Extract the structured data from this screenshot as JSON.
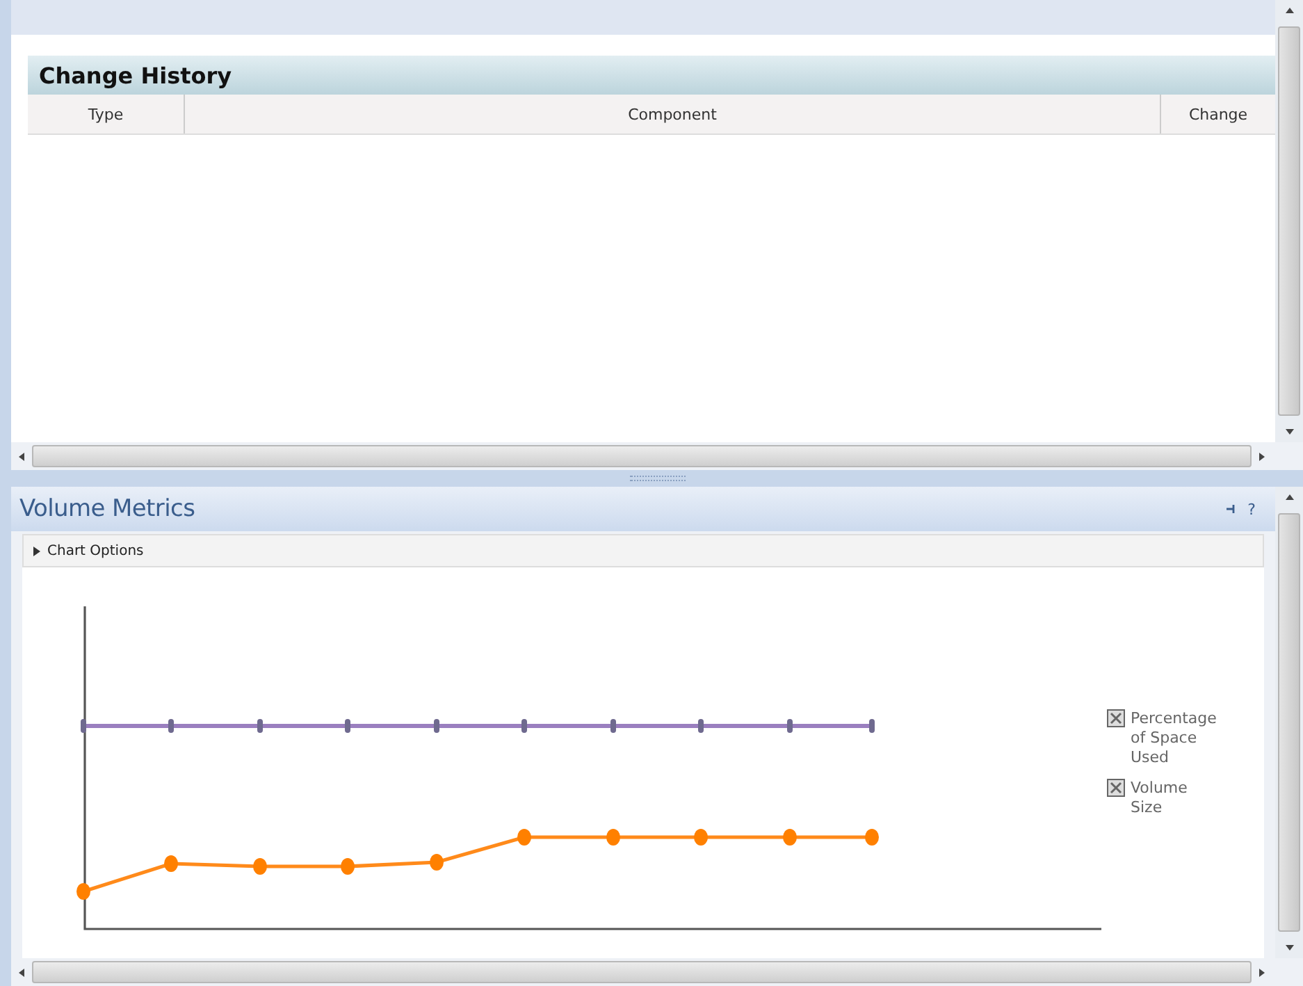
{
  "change_history": {
    "title": "Change History",
    "columns": [
      "Type",
      "Component",
      "Change"
    ]
  },
  "volume_metrics": {
    "title": "Volume Metrics",
    "help": "?",
    "chart_options": {
      "label": "Chart Options",
      "expanded": false
    },
    "legend": [
      "Percentage of Space Used",
      "Volume Size"
    ]
  }
}
